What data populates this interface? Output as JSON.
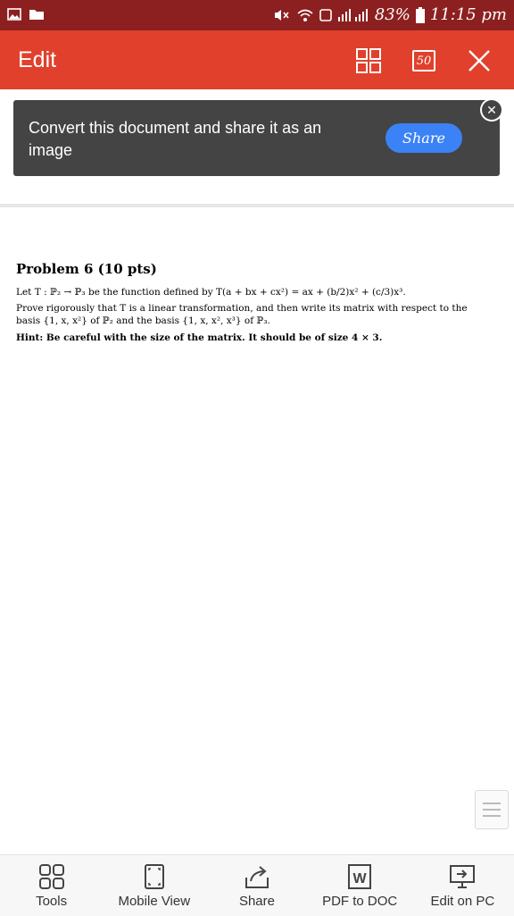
{
  "status_bar": {
    "battery": "83%",
    "time": "11:15 pm"
  },
  "app_bar": {
    "title": "Edit",
    "page_count_badge": "50"
  },
  "banner": {
    "message": "Convert this document and share it as an image",
    "share_label": "Share",
    "close_label": "✕"
  },
  "document": {
    "title": "Problem 6 (10 pts)",
    "line1": "Let T : ℙ₂ → ℙ₃ be the function defined by T(a + bx + cx²) = ax + (b/2)x² + (c/3)x³.",
    "line2": "Prove rigorously that T is a linear transformation, and then write its matrix with respect to the basis {1, x, x²} of ℙ₂ and the basis {1, x, x², x³} of ℙ₃.",
    "hint": "Hint: Be careful with the size of the matrix. It should be of size 4 × 3."
  },
  "bottom_nav": {
    "tools": "Tools",
    "mobile_view": "Mobile View",
    "share": "Share",
    "pdf_to_doc": "PDF to DOC",
    "edit_on_pc": "Edit on PC"
  }
}
